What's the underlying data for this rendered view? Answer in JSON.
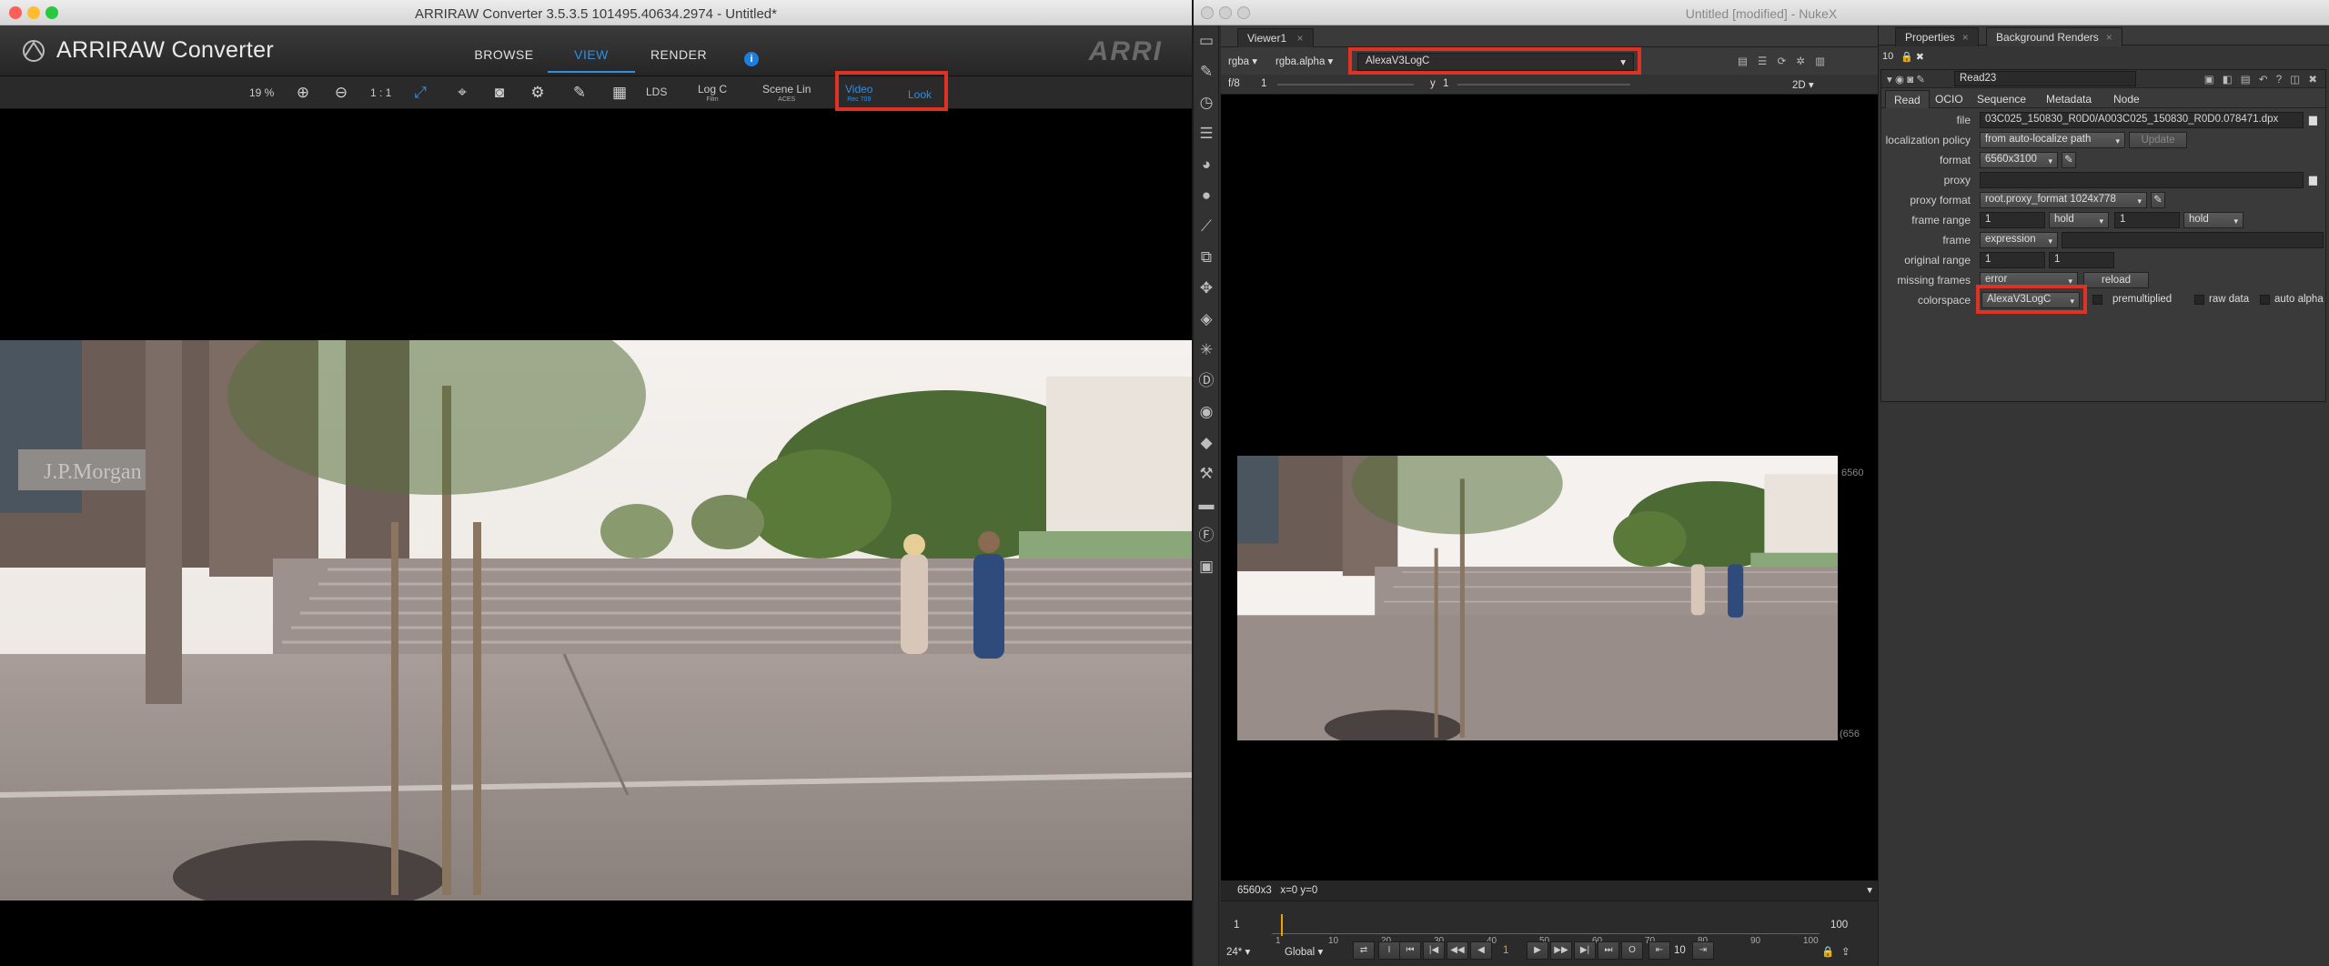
{
  "arri": {
    "window_title": "ARRIRAW Converter 3.5.3.5 101495.40634.2974 - Untitled*",
    "app_name": "ARRIRAW Converter",
    "brand": "ARRI",
    "nav": [
      {
        "label": "BROWSE",
        "active": false
      },
      {
        "label": "VIEW",
        "active": true
      },
      {
        "label": "RENDER",
        "active": false
      }
    ],
    "info_label": "i",
    "toolbar": {
      "zoom": "19 %",
      "one_to_one": "1 : 1",
      "lds": "LDS",
      "log_c": "Log C",
      "log_c_sub": "Film",
      "scene_lin": "Scene Lin",
      "scene_lin_sub": "ACES",
      "video": "Video",
      "video_sub": "Rec 709",
      "look": "Look"
    },
    "image_sign": "J.P.Morgan"
  },
  "nuke": {
    "window_title": "Untitled [modified] - NukeX",
    "viewer_tab": "Viewer1",
    "channels": "rgba",
    "alpha_channel": "rgba.alpha",
    "viewer_process": "AlexaV3LogC",
    "fstop": "f/8",
    "gain": "1",
    "y_label": "y",
    "gamma": "1",
    "view_mode": "2D",
    "format_label_top": "6560",
    "format_label_bottom": "(656",
    "status": "6560x3   x=0 y=0",
    "timeline": {
      "ticks": [
        "1",
        "10",
        "20",
        "30",
        "40",
        "50",
        "60",
        "70",
        "80",
        "90",
        "100"
      ],
      "start": "1",
      "end": "100",
      "fps": "24*",
      "range_mode": "Global",
      "current_frame": "1",
      "increment": "10"
    },
    "props": {
      "tabs": [
        "Properties",
        "Background Renders"
      ],
      "max_panels": "10",
      "node_name": "Read23",
      "subtabs": [
        "Read",
        "OCIO",
        "Sequence",
        "Metadata",
        "Node"
      ],
      "file_label": "file",
      "file": "03C025_150830_R0D0/A003C025_150830_R0D0.078471.dpx",
      "localization_label": "localization policy",
      "localization": "from auto-localize path",
      "update_button": "Update",
      "format_label": "format",
      "format": "6560x3100",
      "proxy_label": "proxy",
      "proxy_format_label": "proxy format",
      "proxy_format": "root.proxy_format 1024x778",
      "frame_range_label": "frame range",
      "frame_range_start": "1",
      "frame_range_start_mode": "hold",
      "frame_range_end": "1",
      "frame_range_end_mode": "hold",
      "frame_label": "frame",
      "frame_mode": "expression",
      "original_range_label": "original range",
      "original_range_start": "1",
      "original_range_end": "1",
      "missing_frames_label": "missing frames",
      "missing_frames": "error",
      "reload_button": "reload",
      "colorspace_label": "colorspace",
      "colorspace": "AlexaV3LogC",
      "premultiplied": "premultiplied",
      "raw_data": "raw data",
      "auto_alpha": "auto alpha"
    }
  },
  "colors": {
    "highlight_red": "#e03222",
    "arri_accent": "#2f8fe2"
  }
}
